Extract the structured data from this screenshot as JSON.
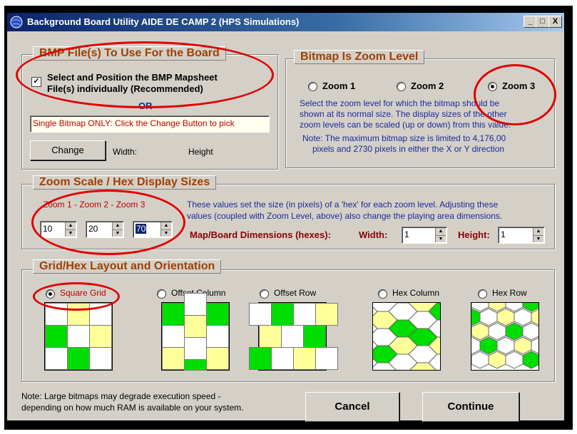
{
  "window": {
    "title": "Background Board Utility  AIDE DE CAMP 2  (HPS Simulations)",
    "controls": [
      "_",
      "□",
      "X"
    ]
  },
  "bmp_group": {
    "title": "BMP File(s) To Use For the  Board",
    "checkbox_label_line1": "Select and Position the BMP Mapsheet",
    "checkbox_label_line2": "File(s) individually (Recommended)",
    "checked": true,
    "or_text": "- OR -",
    "single_bitmap_text": "Single Bitmap ONLY: Click the Change Button to pick",
    "change_button": "Change",
    "width_label": "Width:",
    "height_label": "Height"
  },
  "zoom_level_group": {
    "title": "Bitmap Is Zoom Level",
    "options": [
      "Zoom 1",
      "Zoom 2",
      "Zoom 3"
    ],
    "selected": "Zoom 3",
    "desc_line1": "Select the zoom level for which the bitmap should be",
    "desc_line2": "shown at its normal size.  The display sizes of the other",
    "desc_line3": "zoom levels can be scaled (up or down) from this value.",
    "desc_line4": "Note:  The maximum bitmap size is limited to 4,176,00",
    "desc_line5": "pixels and 2730 pixels in either the X or Y direction"
  },
  "zoom_scale_group": {
    "title": "Zoom Scale / Hex Display Sizes",
    "zoom_labels": "Zoom 1 - Zoom 2 - Zoom 3",
    "zoom1_value": "10",
    "zoom2_value": "20",
    "zoom3_value": "70",
    "desc_line1": "These values set the size (in pixels) of a 'hex' for each zoom level.  Adjusting these",
    "desc_line2": "values (coupled with Zoom Level, above) also change the playing area dimensions.",
    "dimensions_label": "Map/Board Dimensions (hexes):",
    "width_label": "Width:",
    "width_value": "1",
    "height_label": "Height:",
    "height_value": "1"
  },
  "grid_group": {
    "title": "Grid/Hex Layout and Orientation",
    "options": [
      "Square Grid",
      "Offset Column",
      "Offset Row",
      "Hex Column",
      "Hex Row"
    ],
    "selected": "Square Grid"
  },
  "footer": {
    "note_line1": "Note:  Large bitmaps may degrade execution speed -",
    "note_line2": "depending on how much RAM is available on your system.",
    "cancel_button": "Cancel",
    "continue_button": "Continue"
  },
  "colors": {
    "green": "#00dd00",
    "yellow": "#ffff99",
    "white": "#ffffff",
    "annotation_red": "#e00000"
  }
}
